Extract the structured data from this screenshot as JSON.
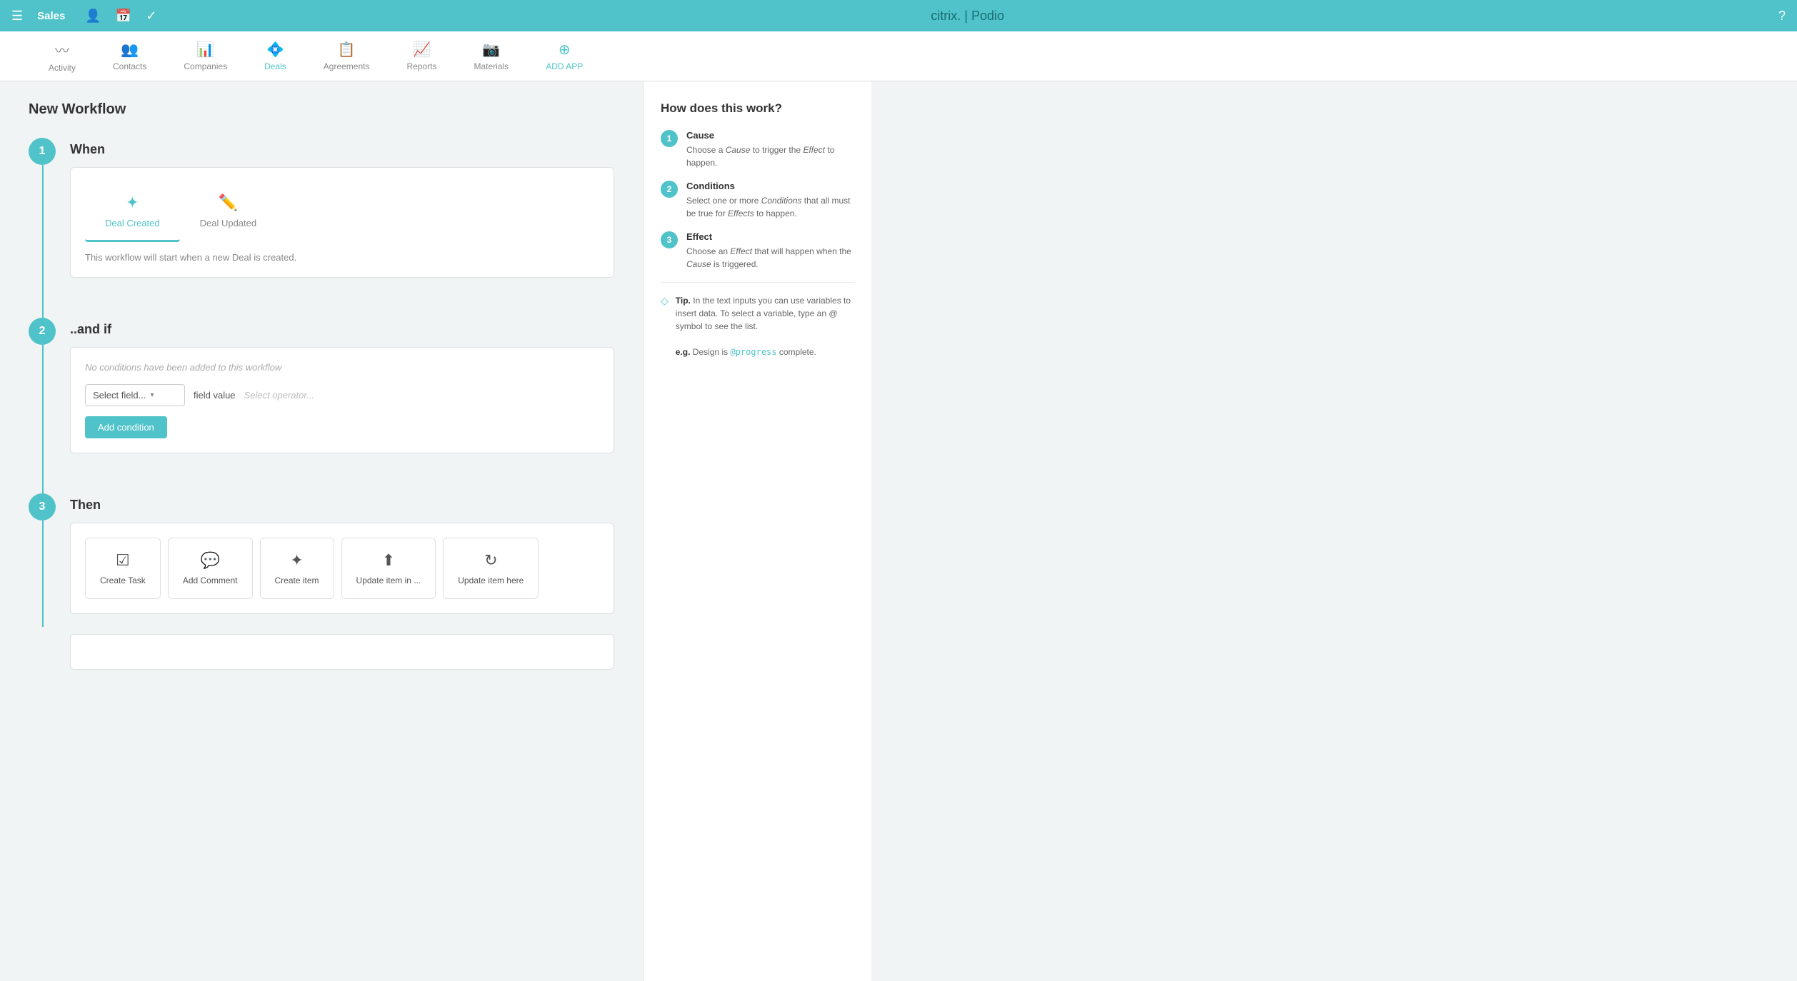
{
  "topbar": {
    "menu_icon": "☰",
    "title": "Sales",
    "icons": [
      "👤",
      "📅",
      "✓"
    ],
    "logo": "citrix. | Podio",
    "help_icon": "?"
  },
  "nav": {
    "items": [
      {
        "id": "activity",
        "label": "Activity",
        "icon": "〜",
        "active": false
      },
      {
        "id": "contacts",
        "label": "Contacts",
        "icon": "👥",
        "active": false
      },
      {
        "id": "companies",
        "label": "Companies",
        "icon": "📊",
        "active": false
      },
      {
        "id": "deals",
        "label": "Deals",
        "icon": "💠",
        "active": true
      },
      {
        "id": "agreements",
        "label": "Agreements",
        "icon": "📋",
        "active": false
      },
      {
        "id": "reports",
        "label": "Reports",
        "icon": "📈",
        "active": false
      },
      {
        "id": "materials",
        "label": "Materials",
        "icon": "📷",
        "active": false
      },
      {
        "id": "add-app",
        "label": "ADD APP",
        "icon": "⊕",
        "active": false,
        "add": true
      }
    ]
  },
  "page": {
    "title": "New Workflow"
  },
  "steps": {
    "step1": {
      "number": "1",
      "label": "When",
      "triggers": [
        {
          "id": "deal-created",
          "label": "Deal Created",
          "icon": "✦",
          "active": true
        },
        {
          "id": "deal-updated",
          "label": "Deal Updated",
          "icon": "✏️",
          "active": false
        }
      ],
      "description": "This workflow will start when a new Deal is created."
    },
    "step2": {
      "number": "2",
      "label": "..and if",
      "empty_message": "No conditions have been added to this workflow",
      "field_placeholder": "Select field...",
      "field_value_label": "field value",
      "operator_placeholder": "Select operator...",
      "add_condition_label": "Add condition"
    },
    "step3": {
      "number": "3",
      "label": "Then",
      "effects": [
        {
          "id": "create-task",
          "label": "Create Task",
          "icon": "☑"
        },
        {
          "id": "add-comment",
          "label": "Add Comment",
          "icon": "💬"
        },
        {
          "id": "create-item",
          "label": "Create item",
          "icon": "✦"
        },
        {
          "id": "update-item-in",
          "label": "Update item in ...",
          "icon": "⬆"
        },
        {
          "id": "update-item-here",
          "label": "Update item here",
          "icon": "↻"
        }
      ]
    }
  },
  "sidebar": {
    "title": "How does this work?",
    "steps": [
      {
        "number": "1",
        "title": "Cause",
        "desc_parts": [
          "Choose a ",
          "Cause",
          " to trigger the ",
          "Effect",
          " to happen."
        ]
      },
      {
        "number": "2",
        "title": "Conditions",
        "desc_parts": [
          "Select one or more ",
          "Conditions",
          " that all must be true for ",
          "Effects",
          " to happen."
        ]
      },
      {
        "number": "3",
        "title": "Effect",
        "desc_parts": [
          "Choose an ",
          "Effect",
          " that will happen when the ",
          "Cause",
          " is triggered."
        ]
      }
    ],
    "tip": {
      "label": "Tip.",
      "text": " In the text inputs you can use variables to insert data. To select a variable, type an @ symbol to see the list.",
      "example_label": "e.g.",
      "example": " Design is @progress complete."
    }
  }
}
